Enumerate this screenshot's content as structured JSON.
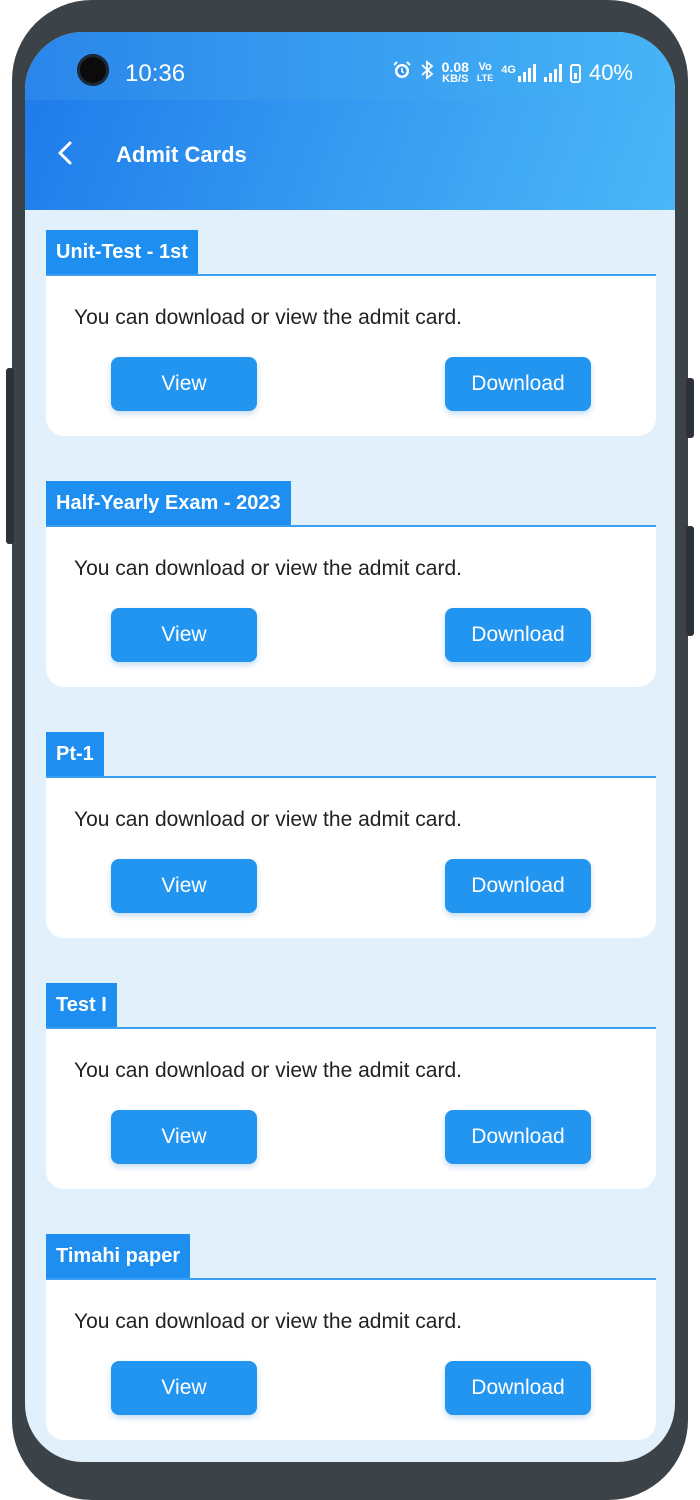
{
  "status_bar": {
    "time": "10:36",
    "network_speed_value": "0.08",
    "network_speed_unit": "KB/S",
    "volte_top": "Vo",
    "volte_bottom": "LTE",
    "network_type": "4G",
    "battery": "40%"
  },
  "app_bar": {
    "title": "Admit Cards"
  },
  "exams": [
    {
      "name": "Unit-Test - 1st",
      "description": "You can download or view the admit card.",
      "view_label": "View",
      "download_label": "Download"
    },
    {
      "name": "Half-Yearly Exam - 2023",
      "description": "You can download or view the admit card.",
      "view_label": "View",
      "download_label": "Download"
    },
    {
      "name": "Pt-1",
      "description": "You can download or view the admit card.",
      "view_label": "View",
      "download_label": "Download"
    },
    {
      "name": "Test I",
      "description": "You can download or view the admit card.",
      "view_label": "View",
      "download_label": "Download"
    },
    {
      "name": "Timahi paper",
      "description": "You can download or view the admit card.",
      "view_label": "View",
      "download_label": "Download"
    }
  ],
  "colors": {
    "primary": "#2295f1",
    "background": "#e2f0fb",
    "appbar_start": "#1f7ceb",
    "appbar_end": "#4bb7f8"
  }
}
